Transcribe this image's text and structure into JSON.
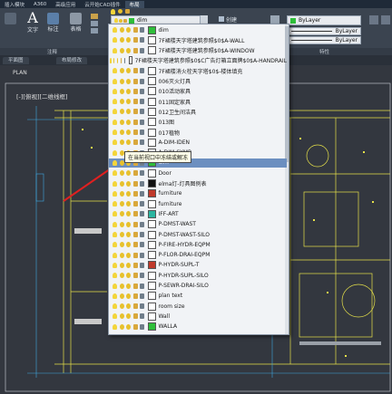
{
  "menubar": {
    "items": [
      "插入模块",
      "A360",
      "高级应用",
      "云开始CAD插件",
      "布局"
    ]
  },
  "ribbon": {
    "text_big": "A",
    "buttons": [
      {
        "label": "文字"
      },
      {
        "label": "标注"
      },
      {
        "label": "表格"
      }
    ],
    "panel_labels": {
      "annotation": "注释",
      "properties": "特性"
    },
    "layer_combo_value": "dim",
    "create_label": "创建",
    "bylayer_values": [
      "ByLayer",
      "ByLayer",
      "ByLayer"
    ]
  },
  "filetabs": [
    "平面图",
    "布局修改"
  ],
  "canvas": {
    "plan_label": "PLAN",
    "viewport_label": "[-][俯视][二维线框]"
  },
  "tooltip": "在当前视口中冻结或解冻",
  "layers": [
    {
      "name": "dim",
      "color": "#2fbf3a",
      "selected": false
    },
    {
      "name": "7F裙楼天字塔建筑参照$0$A-WALL",
      "color": "#ffffff",
      "selected": false
    },
    {
      "name": "7F裙楼天字塔建筑参照$0$A-WINDOW",
      "color": "#ffffff",
      "selected": false
    },
    {
      "name": "7F裙楼天字塔建筑参照$0$C广告灯箱立面牌$0$A-HANDRAIL",
      "color": "#ffffff",
      "selected": false
    },
    {
      "name": "7F裙楼消火栓天字塔$0$-楼体填充",
      "color": "#ffffff",
      "selected": false
    },
    {
      "name": "006灭火灯具",
      "color": "#ffffff",
      "selected": false
    },
    {
      "name": "010活动家具",
      "color": "#ffffff",
      "selected": false
    },
    {
      "name": "011固定家具",
      "color": "#ffffff",
      "selected": false
    },
    {
      "name": "012卫生间洁具",
      "color": "#ffffff",
      "selected": false
    },
    {
      "name": "013图",
      "color": "#ffffff",
      "selected": false
    },
    {
      "name": "017植物",
      "color": "#ffffff",
      "selected": false
    },
    {
      "name": "A-DIM-IDEN",
      "color": "#ffffff",
      "selected": false
    },
    {
      "name": "A-DIM-SYMB",
      "color": "#ffffff",
      "selected": false
    },
    {
      "name": "dim",
      "color": "#2fbf3a",
      "selected": true
    },
    {
      "name": "Door",
      "color": "#ffffff",
      "selected": false
    },
    {
      "name": "elma灯-灯具图例表",
      "color": "#111111",
      "selected": false
    },
    {
      "name": "furniture",
      "color": "#c0392b",
      "selected": false
    },
    {
      "name": "furniture",
      "color": "#ffffff",
      "selected": false
    },
    {
      "name": "IFF-ART",
      "color": "#2bb5a0",
      "selected": false
    },
    {
      "name": "P-DMST-WAST",
      "color": "#ffffff",
      "selected": false
    },
    {
      "name": "P-DMST-WAST-SILO",
      "color": "#ffffff",
      "selected": false
    },
    {
      "name": "P-FIRE-HYDR-EQPM",
      "color": "#ffffff",
      "selected": false
    },
    {
      "name": "P-FLOR-DRAI-EQPM",
      "color": "#ffffff",
      "selected": false
    },
    {
      "name": "P-HYDR-SUPL-T",
      "color": "#c0392b",
      "selected": false
    },
    {
      "name": "P-HYDR-SUPL-SILO",
      "color": "#ffffff",
      "selected": false
    },
    {
      "name": "P-SEWR-DRAI-SILO",
      "color": "#ffffff",
      "selected": false
    },
    {
      "name": "plan text",
      "color": "#ffffff",
      "selected": false
    },
    {
      "name": "room size",
      "color": "#ffffff",
      "selected": false
    },
    {
      "name": "Wall",
      "color": "#ffffff",
      "selected": false
    },
    {
      "name": "WALLA",
      "color": "#2fbf3a",
      "selected": false
    }
  ],
  "colors": {
    "ribbon_bg": "#3b4450",
    "canvas_bg": "#33373f",
    "selection": "#6c8fc0",
    "arrow": "#e02020",
    "wall_lines": "#e6e14a"
  }
}
